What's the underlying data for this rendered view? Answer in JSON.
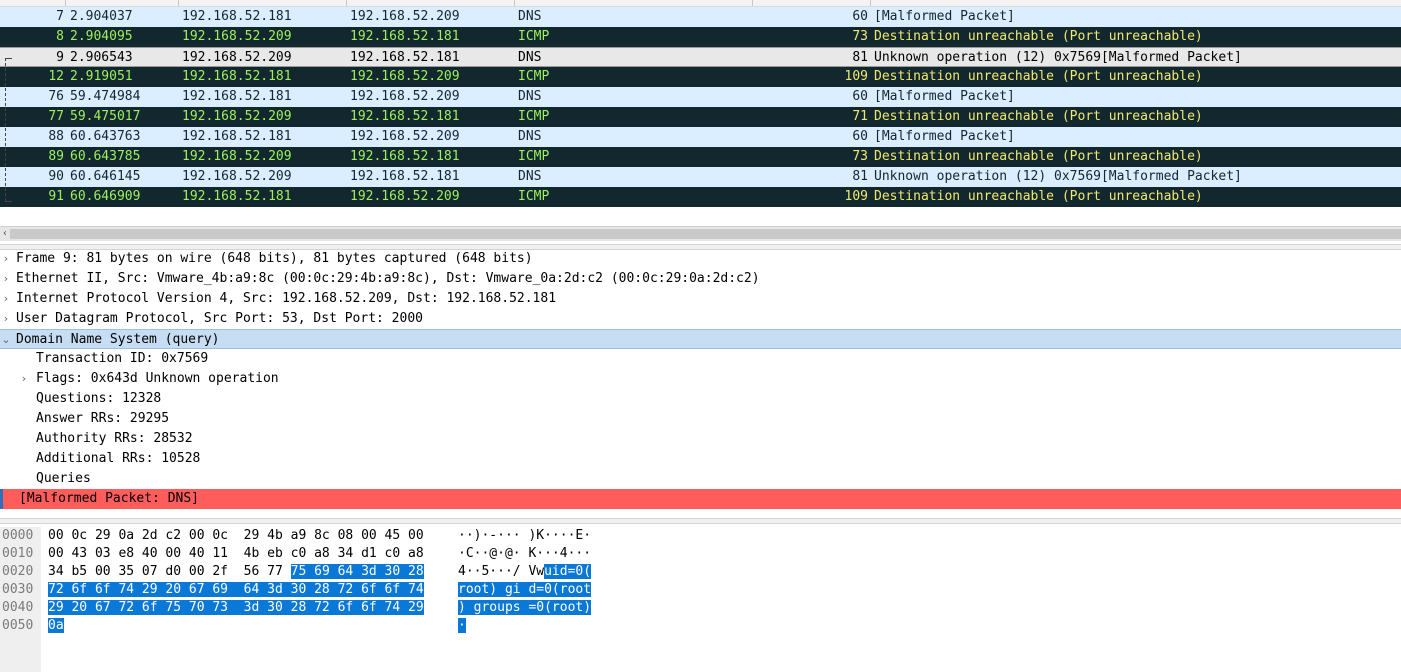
{
  "packets": [
    {
      "no": "7",
      "time": "2.904037",
      "src": "192.168.52.181",
      "dst": "192.168.52.209",
      "proto": "DNS",
      "len": "60",
      "info": "[Malformed Packet]",
      "kind": "dns"
    },
    {
      "no": "8",
      "time": "2.904095",
      "src": "192.168.52.209",
      "dst": "192.168.52.181",
      "proto": "ICMP",
      "len": "73",
      "info": "Destination unreachable (Port unreachable)",
      "kind": "icmp"
    },
    {
      "no": "9",
      "time": "2.906543",
      "src": "192.168.52.209",
      "dst": "192.168.52.181",
      "proto": "DNS",
      "len": "81",
      "info": "Unknown operation (12) 0x7569[Malformed Packet]",
      "kind": "sel"
    },
    {
      "no": "12",
      "time": "2.919051",
      "src": "192.168.52.181",
      "dst": "192.168.52.209",
      "proto": "ICMP",
      "len": "109",
      "info": "Destination unreachable (Port unreachable)",
      "kind": "icmp"
    },
    {
      "no": "76",
      "time": "59.474984",
      "src": "192.168.52.181",
      "dst": "192.168.52.209",
      "proto": "DNS",
      "len": "60",
      "info": "[Malformed Packet]",
      "kind": "dns"
    },
    {
      "no": "77",
      "time": "59.475017",
      "src": "192.168.52.209",
      "dst": "192.168.52.181",
      "proto": "ICMP",
      "len": "71",
      "info": "Destination unreachable (Port unreachable)",
      "kind": "icmp"
    },
    {
      "no": "88",
      "time": "60.643763",
      "src": "192.168.52.181",
      "dst": "192.168.52.209",
      "proto": "DNS",
      "len": "60",
      "info": "[Malformed Packet]",
      "kind": "dns"
    },
    {
      "no": "89",
      "time": "60.643785",
      "src": "192.168.52.209",
      "dst": "192.168.52.181",
      "proto": "ICMP",
      "len": "73",
      "info": "Destination unreachable (Port unreachable)",
      "kind": "icmp"
    },
    {
      "no": "90",
      "time": "60.646145",
      "src": "192.168.52.209",
      "dst": "192.168.52.181",
      "proto": "DNS",
      "len": "81",
      "info": "Unknown operation (12) 0x7569[Malformed Packet]",
      "kind": "dns"
    },
    {
      "no": "91",
      "time": "60.646909",
      "src": "192.168.52.181",
      "dst": "192.168.52.209",
      "proto": "ICMP",
      "len": "109",
      "info": "Destination unreachable (Port unreachable)",
      "kind": "icmp"
    }
  ],
  "details": [
    {
      "arrow": "›",
      "text": "Frame 9: 81 bytes on wire (648 bits), 81 bytes captured (648 bits)",
      "level": 0,
      "state": ""
    },
    {
      "arrow": "›",
      "text": "Ethernet II, Src: Vmware_4b:a9:8c (00:0c:29:4b:a9:8c), Dst: Vmware_0a:2d:c2 (00:0c:29:0a:2d:c2)",
      "level": 0,
      "state": ""
    },
    {
      "arrow": "›",
      "text": "Internet Protocol Version 4, Src: 192.168.52.209, Dst: 192.168.52.181",
      "level": 0,
      "state": ""
    },
    {
      "arrow": "›",
      "text": "User Datagram Protocol, Src Port: 53, Dst Port: 2000",
      "level": 0,
      "state": ""
    },
    {
      "arrow": "⌄",
      "text": "Domain Name System (query)",
      "level": 0,
      "state": "selected"
    },
    {
      "arrow": "",
      "text": "Transaction ID: 0x7569",
      "level": 1,
      "state": ""
    },
    {
      "arrow": "›",
      "text": "Flags: 0x643d Unknown operation",
      "level": 1,
      "state": ""
    },
    {
      "arrow": "",
      "text": "Questions: 12328",
      "level": 1,
      "state": ""
    },
    {
      "arrow": "",
      "text": "Answer RRs: 29295",
      "level": 1,
      "state": ""
    },
    {
      "arrow": "",
      "text": "Authority RRs: 28532",
      "level": 1,
      "state": ""
    },
    {
      "arrow": "",
      "text": "Additional RRs: 10528",
      "level": 1,
      "state": ""
    },
    {
      "arrow": "",
      "text": "Queries",
      "level": 1,
      "state": ""
    },
    {
      "arrow": "",
      "text": "[Malformed Packet: DNS]",
      "level": 0,
      "state": "error"
    }
  ],
  "bytes": [
    {
      "off": "0000",
      "hex": "00 0c 29 0a 2d c2 00 0c  29 4b a9 8c 08 00 45 00",
      "hex_hl": "",
      "asc": "··)·-··· )K····E·",
      "asc_hl": ""
    },
    {
      "off": "0010",
      "hex": "00 43 03 e8 40 00 40 11  4b eb c0 a8 34 d1 c0 a8",
      "hex_hl": "",
      "asc": "·C··@·@· K···4···",
      "asc_hl": ""
    },
    {
      "off": "0020",
      "hex": "34 b5 00 35 07 d0 00 2f  56 77 ",
      "hex_hl": "75 69 64 3d 30 28",
      "asc": "4··5···/ Vw",
      "asc_hl": "uid=0("
    },
    {
      "off": "0030",
      "hex": "",
      "hex_hl": "72 6f 6f 74 29 20 67 69  64 3d 30 28 72 6f 6f 74",
      "asc": "",
      "asc_hl": "root) gi d=0(root"
    },
    {
      "off": "0040",
      "hex": "",
      "hex_hl": "29 20 67 72 6f 75 70 73  3d 30 28 72 6f 6f 74 29",
      "asc": "",
      "asc_hl": ") groups =0(root)"
    },
    {
      "off": "0050",
      "hex": "",
      "hex_hl": "0a",
      "asc": "",
      "asc_hl": "·"
    }
  ]
}
